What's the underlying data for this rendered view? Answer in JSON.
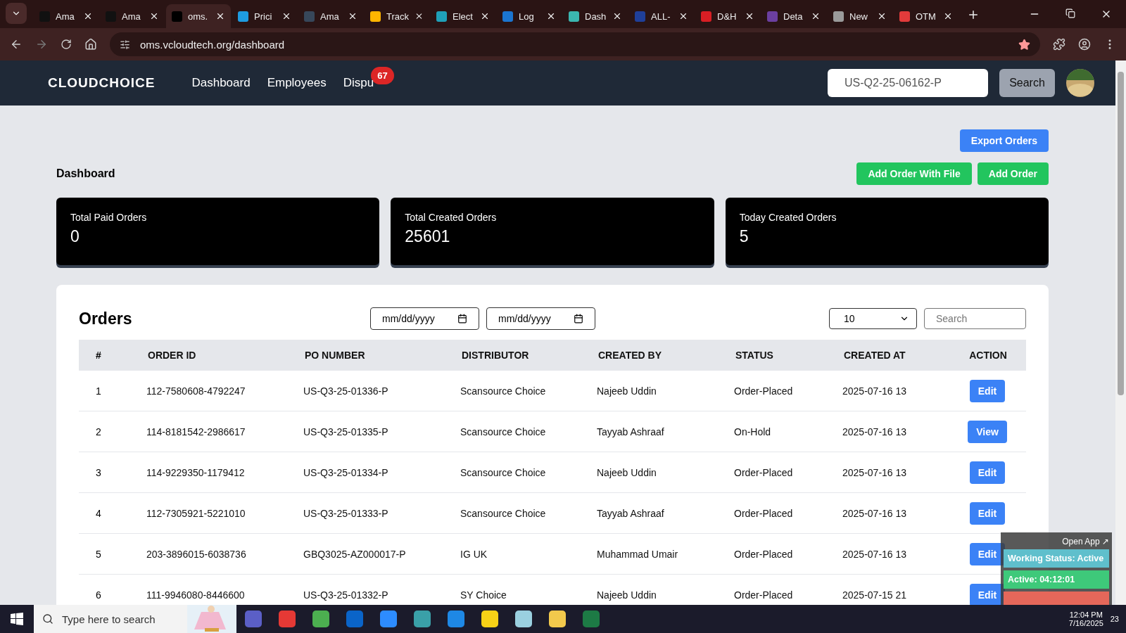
{
  "browser": {
    "tabs": [
      {
        "label": "Ama",
        "selected": false,
        "color": "#111111"
      },
      {
        "label": "Ama",
        "selected": false,
        "color": "#111111"
      },
      {
        "label": "oms.",
        "selected": true,
        "color": "#000000"
      },
      {
        "label": "Prici",
        "selected": false,
        "color": "#1e9be0"
      },
      {
        "label": "Ama",
        "selected": false,
        "color": "#37475a"
      },
      {
        "label": "Track",
        "selected": false,
        "color": "#ffb500"
      },
      {
        "label": "Elect",
        "selected": false,
        "color": "#1fa0b8"
      },
      {
        "label": "Log",
        "selected": false,
        "color": "#1b75d0"
      },
      {
        "label": "Dash",
        "selected": false,
        "color": "#3bb6b0"
      },
      {
        "label": "ALL-",
        "selected": false,
        "color": "#1f3f99"
      },
      {
        "label": "D&H",
        "selected": false,
        "color": "#d81e24"
      },
      {
        "label": "Deta",
        "selected": false,
        "color": "#6b3fa0"
      },
      {
        "label": "New",
        "selected": false,
        "color": "#9a9a9a"
      },
      {
        "label": "OTM",
        "selected": false,
        "color": "#e23b3b"
      }
    ],
    "url": "oms.vcloudtech.org/dashboard"
  },
  "navbar": {
    "logo": "CLOUDCHOICE",
    "links": [
      {
        "label": "Dashboard"
      },
      {
        "label": "Employees"
      },
      {
        "label": "Dispu",
        "badge": "67"
      }
    ],
    "search_value": "US-Q2-25-06162-P",
    "search_button": "Search"
  },
  "header": {
    "export_button": "Export Orders",
    "title": "Dashboard",
    "buttons": [
      "Add Order With File",
      "Add Order"
    ]
  },
  "stats": [
    {
      "label": "Total Paid Orders",
      "value": "0"
    },
    {
      "label": "Total Created Orders",
      "value": "25601"
    },
    {
      "label": "Today Created Orders",
      "value": "5"
    }
  ],
  "orders": {
    "title": "Orders",
    "date_from": {
      "placeholder": "mm/dd/yyyy"
    },
    "date_to": {
      "placeholder": "mm/dd/yyyy"
    },
    "page_size": "10",
    "search": {
      "placeholder": "Search"
    },
    "columns": [
      "#",
      "ORDER ID",
      "PO NUMBER",
      "DISTRIBUTOR",
      "CREATED BY",
      "STATUS",
      "CREATED AT",
      "ACTION"
    ],
    "rows": [
      {
        "cells": [
          "1",
          "112-7580608-4792247",
          "US-Q3-25-01336-P",
          "Scansource Choice",
          "Najeeb Uddin",
          "Order-Placed",
          "2025-07-16 13"
        ],
        "action": "Edit"
      },
      {
        "cells": [
          "2",
          "114-8181542-2986617",
          "US-Q3-25-01335-P",
          "Scansource Choice",
          "Tayyab Ashraaf",
          "On-Hold",
          "2025-07-16 13"
        ],
        "action": "View"
      },
      {
        "cells": [
          "3",
          "114-9229350-1179412",
          "US-Q3-25-01334-P",
          "Scansource Choice",
          "Najeeb Uddin",
          "Order-Placed",
          "2025-07-16 13"
        ],
        "action": "Edit"
      },
      {
        "cells": [
          "4",
          "112-7305921-5221010",
          "US-Q3-25-01333-P",
          "Scansource Choice",
          "Tayyab Ashraaf",
          "Order-Placed",
          "2025-07-16 13"
        ],
        "action": "Edit"
      },
      {
        "cells": [
          "5",
          "203-3896015-6038736",
          "GBQ3025-AZ000017-P",
          "IG UK",
          "Muhammad Umair",
          "Order-Placed",
          "2025-07-16 13"
        ],
        "action": "Edit"
      },
      {
        "cells": [
          "6",
          "111-9946080-8446600",
          "US-Q3-25-01332-P",
          "SY Choice",
          "Najeeb Uddin",
          "Order-Placed",
          "2025-07-15 21"
        ],
        "action": "Edit"
      }
    ]
  },
  "tracker": {
    "open_link": "Open App ↗",
    "status": "Working Status: Active",
    "active": "Active: 04:12:01"
  },
  "taskbar": {
    "search_placeholder": "Type here to search",
    "time": "12:04 PM",
    "date": "7/16/2025",
    "notifications": "23"
  }
}
